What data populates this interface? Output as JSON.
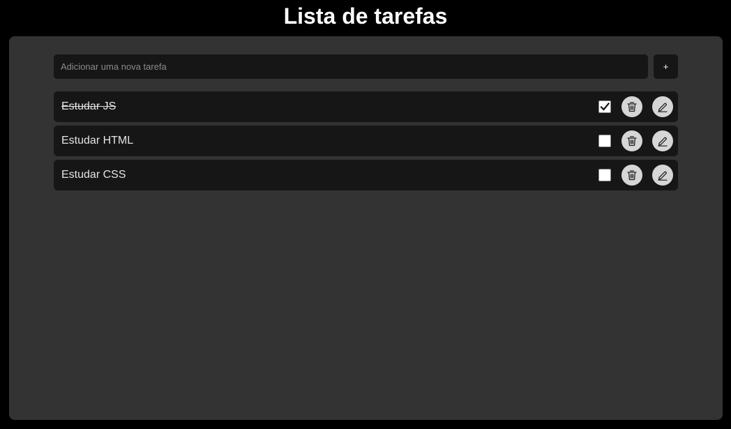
{
  "header": {
    "title": "Lista de tarefas"
  },
  "new_task": {
    "placeholder": "Adicionar uma nova tarefa",
    "value": "",
    "add_label": "+"
  },
  "tasks": [
    {
      "text": "Estudar JS",
      "completed": true
    },
    {
      "text": "Estudar HTML",
      "completed": false
    },
    {
      "text": "Estudar CSS",
      "completed": false
    }
  ],
  "icons": {
    "delete": "trash-icon",
    "edit": "pencil-icon",
    "check": "checkmark-icon"
  },
  "colors": {
    "background": "#000000",
    "panel": "#333333",
    "row": "#161616",
    "round_button": "#d6d6d6",
    "text": "#e4e4e4"
  }
}
